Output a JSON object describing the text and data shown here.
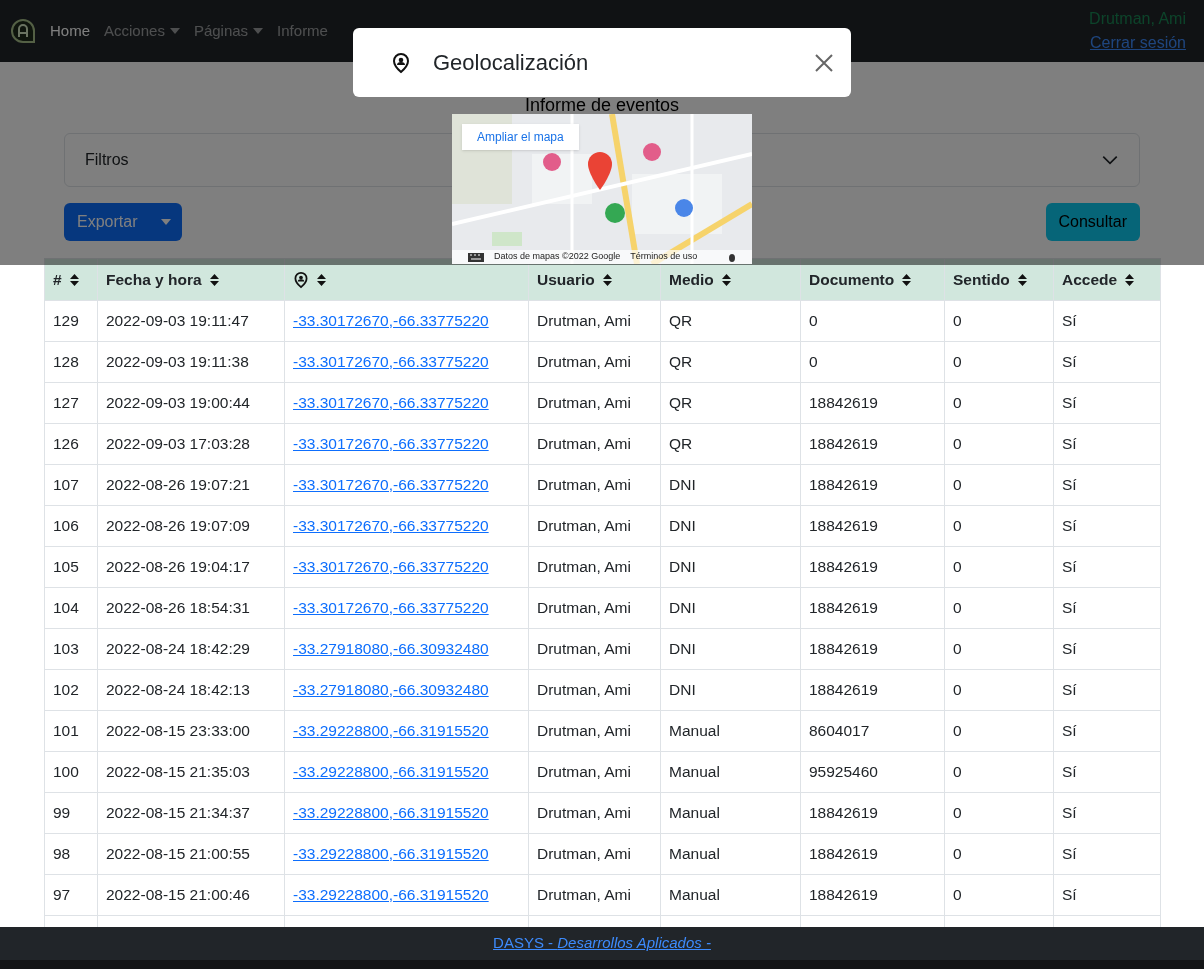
{
  "navbar": {
    "items": [
      {
        "label": "Home",
        "dropdown": false,
        "selected": true
      },
      {
        "label": "Acciones",
        "dropdown": true,
        "selected": false
      },
      {
        "label": "Páginas",
        "dropdown": true,
        "selected": false
      },
      {
        "label": "Informe",
        "dropdown": false,
        "selected": false
      }
    ],
    "user": "Drutman, Ami",
    "logout": "Cerrar sesión"
  },
  "page": {
    "title": "Informe de eventos",
    "filters": {
      "label": "Filtros",
      "expanded": false
    },
    "export_button": "Exportar",
    "consult_button": "Consultar"
  },
  "table": {
    "columns": [
      {
        "kind": "text",
        "label": "#"
      },
      {
        "kind": "text",
        "label": "Fecha y hora"
      },
      {
        "kind": "location"
      },
      {
        "kind": "text",
        "label": "Usuario"
      },
      {
        "kind": "text",
        "label": "Medio"
      },
      {
        "kind": "text",
        "label": "Documento"
      },
      {
        "kind": "text",
        "label": "Sentido"
      },
      {
        "kind": "text",
        "label": "Accede"
      }
    ],
    "rows": [
      [
        "129",
        "2022-09-03 19:11:47",
        "-33.30172670,-66.33775220",
        "Drutman, Ami",
        "QR",
        "0",
        "0",
        "Sí"
      ],
      [
        "128",
        "2022-09-03 19:11:38",
        "-33.30172670,-66.33775220",
        "Drutman, Ami",
        "QR",
        "0",
        "0",
        "Sí"
      ],
      [
        "127",
        "2022-09-03 19:00:44",
        "-33.30172670,-66.33775220",
        "Drutman, Ami",
        "QR",
        "18842619",
        "0",
        "Sí"
      ],
      [
        "126",
        "2022-09-03 17:03:28",
        "-33.30172670,-66.33775220",
        "Drutman, Ami",
        "QR",
        "18842619",
        "0",
        "Sí"
      ],
      [
        "107",
        "2022-08-26 19:07:21",
        "-33.30172670,-66.33775220",
        "Drutman, Ami",
        "DNI",
        "18842619",
        "0",
        "Sí"
      ],
      [
        "106",
        "2022-08-26 19:07:09",
        "-33.30172670,-66.33775220",
        "Drutman, Ami",
        "DNI",
        "18842619",
        "0",
        "Sí"
      ],
      [
        "105",
        "2022-08-26 19:04:17",
        "-33.30172670,-66.33775220",
        "Drutman, Ami",
        "DNI",
        "18842619",
        "0",
        "Sí"
      ],
      [
        "104",
        "2022-08-26 18:54:31",
        "-33.30172670,-66.33775220",
        "Drutman, Ami",
        "DNI",
        "18842619",
        "0",
        "Sí"
      ],
      [
        "103",
        "2022-08-24 18:42:29",
        "-33.27918080,-66.30932480",
        "Drutman, Ami",
        "DNI",
        "18842619",
        "0",
        "Sí"
      ],
      [
        "102",
        "2022-08-24 18:42:13",
        "-33.27918080,-66.30932480",
        "Drutman, Ami",
        "DNI",
        "18842619",
        "0",
        "Sí"
      ],
      [
        "101",
        "2022-08-15 23:33:00",
        "-33.29228800,-66.31915520",
        "Drutman, Ami",
        "Manual",
        "8604017",
        "0",
        "Sí"
      ],
      [
        "100",
        "2022-08-15 21:35:03",
        "-33.29228800,-66.31915520",
        "Drutman, Ami",
        "Manual",
        "95925460",
        "0",
        "Sí"
      ],
      [
        "99",
        "2022-08-15 21:34:37",
        "-33.29228800,-66.31915520",
        "Drutman, Ami",
        "Manual",
        "18842619",
        "0",
        "Sí"
      ],
      [
        "98",
        "2022-08-15 21:00:55",
        "-33.29228800,-66.31915520",
        "Drutman, Ami",
        "Manual",
        "18842619",
        "0",
        "Sí"
      ],
      [
        "97",
        "2022-08-15 21:00:46",
        "-33.29228800,-66.31915520",
        "Drutman, Ami",
        "Manual",
        "18842619",
        "0",
        "Sí"
      ]
    ]
  },
  "modal": {
    "title": "Geolocalización",
    "map": {
      "kind": "picture",
      "enlarge_button": "Ampliar el mapa",
      "attribution": "Datos de mapas ©2022 Google",
      "terms": "Términos de uso"
    }
  },
  "footer": "DASYS - *Desarrollos Aplicados -*"
}
